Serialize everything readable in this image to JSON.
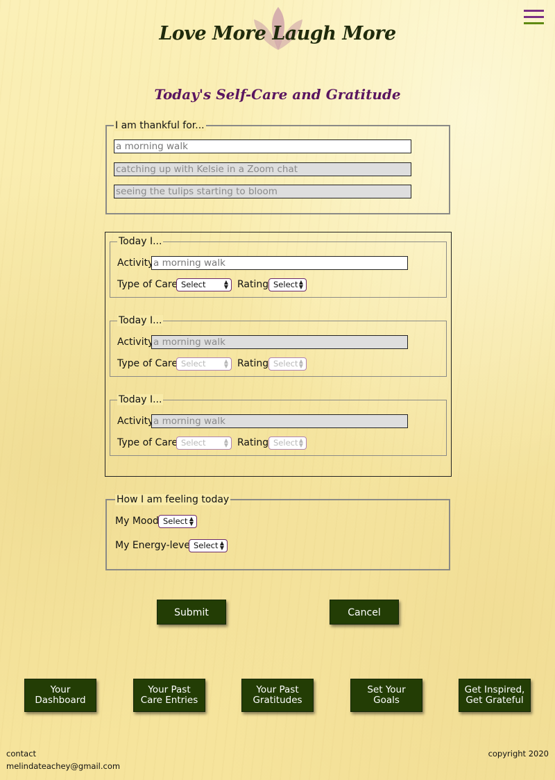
{
  "header": {
    "title": "Love More Laugh More",
    "logo_icon": "lotus-icon",
    "menu_icon": "hamburger-menu-icon"
  },
  "page_title": "Today's Self-Care and Gratitude",
  "gratitude": {
    "legend": "I am thankful for...",
    "placeholders": [
      "a morning walk",
      "catching up with Kelsie in a Zoom chat",
      "seeing the tulips starting to bloom"
    ]
  },
  "care": {
    "entries": [
      {
        "legend": "Today I...",
        "activity_label": "Activity",
        "activity_placeholder": "a morning walk",
        "type_label": "Type of Care",
        "type_value": "Select",
        "rating_label": "Rating",
        "rating_value": "Select"
      },
      {
        "legend": "Today I...",
        "activity_label": "Activity",
        "activity_placeholder": "a morning walk",
        "type_label": "Type of Care",
        "type_value": "Select",
        "rating_label": "Rating",
        "rating_value": "Select"
      },
      {
        "legend": "Today I...",
        "activity_label": "Activity",
        "activity_placeholder": "a morning walk",
        "type_label": "Type of Care",
        "type_value": "Select",
        "rating_label": "Rating",
        "rating_value": "Select"
      }
    ]
  },
  "feeling": {
    "legend": "How I am feeling today",
    "mood_label": "My Mood",
    "mood_value": "Select",
    "energy_label": "My Energy-level",
    "energy_value": "Select"
  },
  "buttons": {
    "submit": "Submit",
    "cancel": "Cancel"
  },
  "nav": [
    {
      "line1": "Your",
      "line2": "Dashboard"
    },
    {
      "line1": "Your Past",
      "line2": "Care Entries"
    },
    {
      "line1": "Your Past",
      "line2": "Gratitudes"
    },
    {
      "line1": "Set Your",
      "line2": "Goals"
    },
    {
      "line1": "Get Inspired,",
      "line2": "Get Grateful"
    }
  ],
  "footer": {
    "contact_label": "contact",
    "email": "melindateachey@gmail.com",
    "copyright": "copyright 2020"
  },
  "colors": {
    "accent_purple": "#7a2f84",
    "accent_green": "#5f8a12",
    "button_green": "#233d05",
    "title_purple": "#5a1660"
  }
}
